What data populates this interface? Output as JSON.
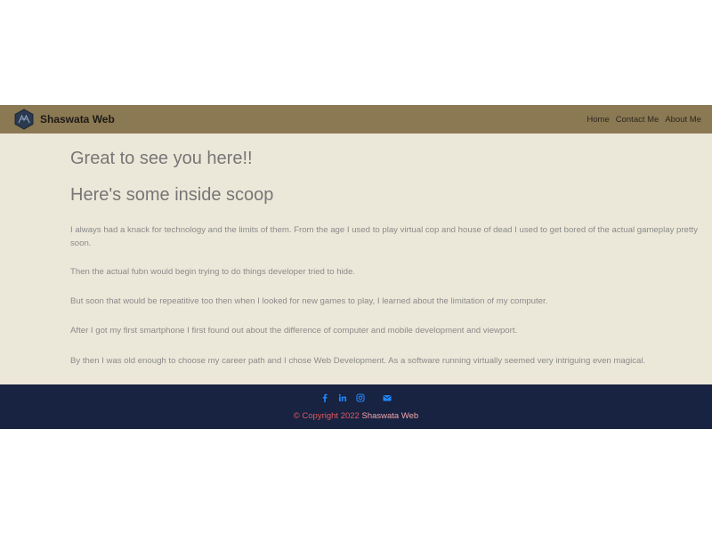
{
  "navbar": {
    "brand": "Shaswata Web",
    "logo_icon": "hexagon-logo-icon",
    "links": [
      "Home",
      "Contact Me",
      "About Me"
    ],
    "bg_color": "#8b7953"
  },
  "main": {
    "heading_1": "Great to see you here!!",
    "heading_2": "Here's some inside scoop",
    "paragraphs": [
      "I always had a knack for technology and the limits of them. From the age I used to play virtual cop and house of dead I used to get bored of the actual gameplay pretty soon.",
      "Then the actual fubn would begin trying to do things developer tried to hide.",
      "But soon that would be repeatitive too then when I looked for new games to play, I learned about the limitation of my computer.",
      "After I got my first smartphone I first found out about the difference of computer and mobile development and viewport.",
      "By then I was old enough to choose my career path and I chose Web Development. As a software running virtually seemed very intriguing even magical."
    ],
    "bg_color": "#ece8d9"
  },
  "footer": {
    "social_icons": [
      "facebook-icon",
      "linkedin-icon",
      "instagram-icon",
      "envelope-icon"
    ],
    "copyright_text": "© Copyright 2022",
    "copyright_site": "Shaswata Web",
    "bg_color": "#182241",
    "icon_color": "#1e88ff"
  }
}
